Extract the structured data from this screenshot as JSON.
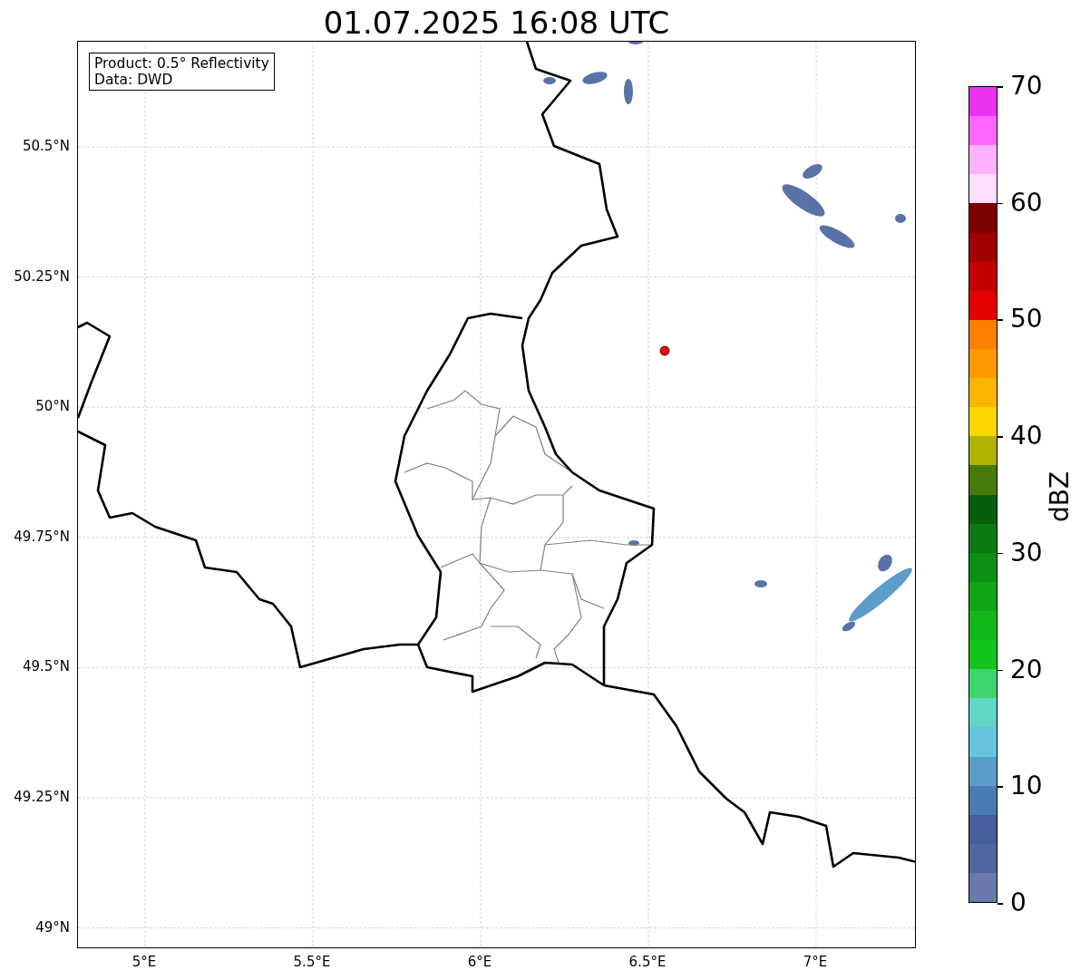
{
  "title": "01.07.2025 16:08 UTC",
  "legend": {
    "lines": [
      "Product: 0.5° Reflectivity",
      "Data: DWD"
    ]
  },
  "map": {
    "xticks": [
      "5°E",
      "5.5°E",
      "6°E",
      "6.5°E",
      "7°E"
    ],
    "yticks": [
      "50.5°N",
      "50.25°N",
      "50°N",
      "49.75°N",
      "49.5°N",
      "49.25°N",
      "49°N"
    ]
  },
  "colorbar": {
    "label": "dBZ",
    "ticks": [
      "70",
      "60",
      "50",
      "40",
      "30",
      "20",
      "10",
      "0"
    ],
    "bands": [
      {
        "color": "#ea33ee"
      },
      {
        "color": "#ff66ff"
      },
      {
        "color": "#ffb3ff"
      },
      {
        "color": "#ffddff"
      },
      {
        "color": "#7c0000"
      },
      {
        "color": "#a00000"
      },
      {
        "color": "#c40000"
      },
      {
        "color": "#e40000"
      },
      {
        "color": "#ff7f00"
      },
      {
        "color": "#ff9a00"
      },
      {
        "color": "#ffb500"
      },
      {
        "color": "#ffd700"
      },
      {
        "color": "#aeb304"
      },
      {
        "color": "#467a0a"
      },
      {
        "color": "#075f0d"
      },
      {
        "color": "#0b7a12"
      },
      {
        "color": "#0d8f14"
      },
      {
        "color": "#0fa516"
      },
      {
        "color": "#10b81a"
      },
      {
        "color": "#12c71c"
      },
      {
        "color": "#3dd46e"
      },
      {
        "color": "#61d6c4"
      },
      {
        "color": "#66c3dc"
      },
      {
        "color": "#5b9cc8"
      },
      {
        "color": "#4a7bb3"
      },
      {
        "color": "#445ea0"
      },
      {
        "color": "#53679f"
      },
      {
        "color": "#6a78aa"
      }
    ]
  }
}
